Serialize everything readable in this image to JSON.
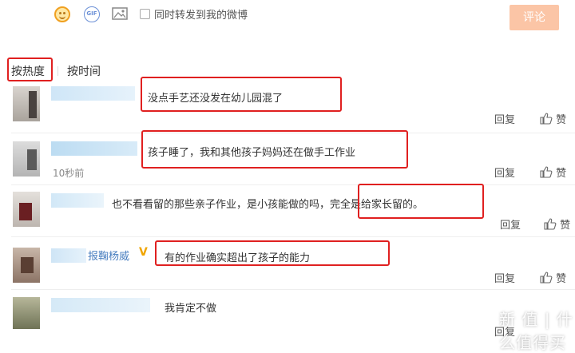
{
  "toolbar": {
    "emoji_icon": "smiley-face-icon",
    "gif_label": "GIF",
    "image_icon": "image-icon",
    "forward_label": "同时转发到我的微博",
    "submit_label": "评论"
  },
  "sort_tabs": [
    "按热度",
    "按时间"
  ],
  "comments": [
    {
      "text": "没点手艺还没发在幼儿园混了",
      "reply": "回复",
      "like": "赞"
    },
    {
      "text": "孩子睡了，我和其他孩子妈妈还在做手工作业",
      "time": "10秒前",
      "reply": "回复",
      "like": "赞"
    },
    {
      "text_before": "也不看看留的那些亲子作业，是小孩能做的吗，",
      "text_highlight": "完全是给家长留的。",
      "reply": "回复",
      "like": "赞"
    },
    {
      "name": "报鞠杨威",
      "text": "有的作业确实超出了孩子的能力",
      "reply": "回复",
      "like": "赞"
    },
    {
      "text": "我肯定不做",
      "reply": "回复"
    }
  ],
  "colors": {
    "highlight_box": "#e02020",
    "submit_bg": "#fbc5a6",
    "name_link": "#4a7fc0"
  },
  "watermark": "新 值 | 什么值得买"
}
